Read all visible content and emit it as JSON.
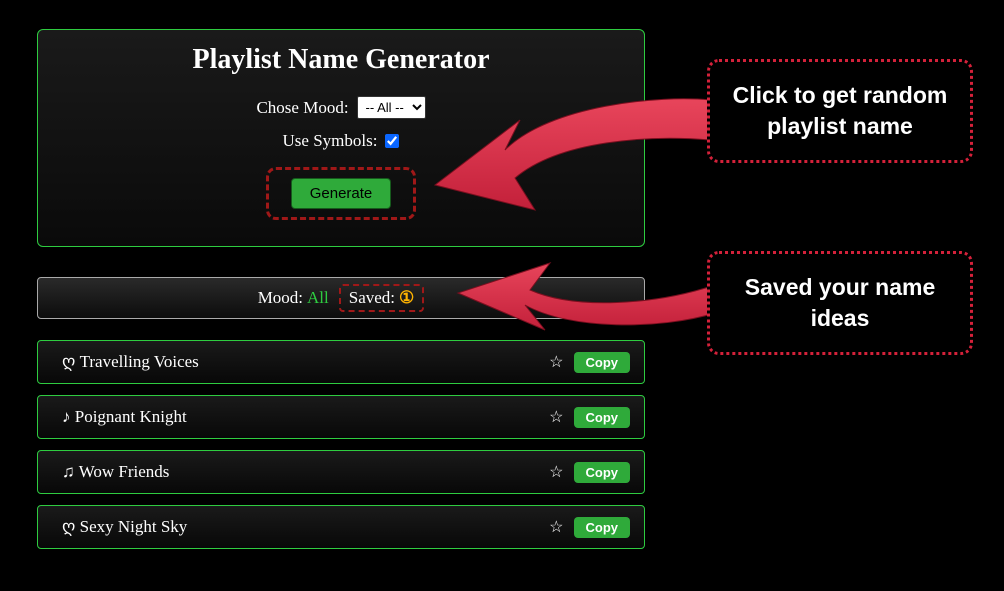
{
  "panel": {
    "title": "Playlist Name Generator",
    "mood_label": "Chose Mood:",
    "mood_selected": "-- All --",
    "symbols_label": "Use Symbols:",
    "symbols_checked": true,
    "generate_label": "Generate"
  },
  "status": {
    "mood_label": "Mood:",
    "mood_value": "All",
    "saved_label": "Saved:",
    "saved_count": "①"
  },
  "results": [
    {
      "name": "ღ Travelling Voices",
      "copy": "Copy"
    },
    {
      "name": "♪ Poignant Knight",
      "copy": "Copy"
    },
    {
      "name": "♫ Wow Friends",
      "copy": "Copy"
    },
    {
      "name": "ღ Sexy Night Sky",
      "copy": "Copy"
    }
  ],
  "callouts": {
    "c1": "Click to get random playlist name",
    "c2": "Saved your name ideas"
  }
}
